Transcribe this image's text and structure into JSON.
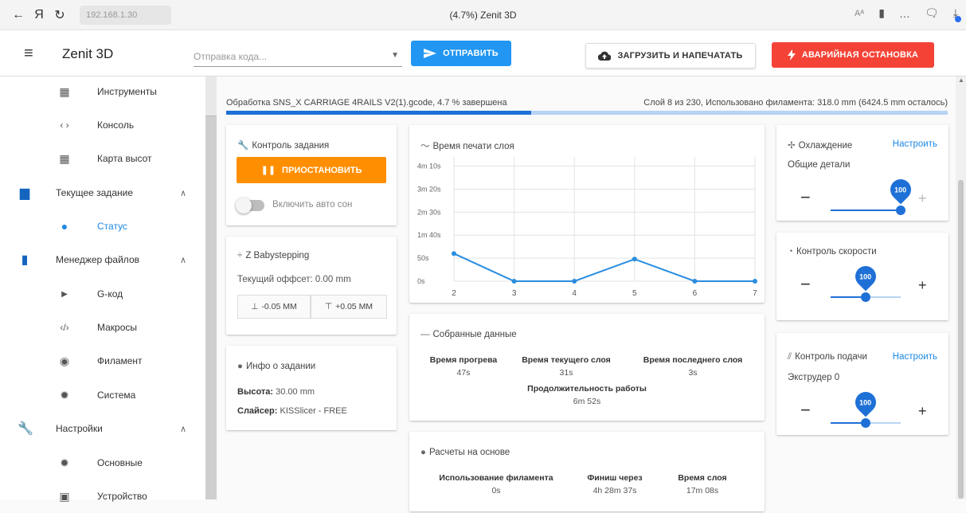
{
  "browser": {
    "address": "192.168.1.30",
    "tab_title": "(4.7%) Zenit 3D"
  },
  "appbar": {
    "title": "Zenit 3D",
    "gcode_placeholder": "Отправка кода...",
    "send_label": "ОТПРАВИТЬ",
    "upload_label": "ЗАГРУЗИТЬ И НАПЕЧАТАТЬ",
    "stop_label": "АВАРИЙНАЯ ОСТАНОВКА"
  },
  "sidebar": {
    "items": [
      {
        "label": "Инструменты",
        "icon": "tools-icon",
        "level": "child"
      },
      {
        "label": "Консоль",
        "icon": "code-icon",
        "level": "child"
      },
      {
        "label": "Карта высот",
        "icon": "grid-icon",
        "level": "child"
      },
      {
        "label": "Текущее задание",
        "icon": "printer-icon",
        "level": "parent"
      },
      {
        "label": "Статус",
        "icon": "info-icon",
        "level": "child",
        "active": true
      },
      {
        "label": "Менеджер файлов",
        "icon": "sd-card-icon",
        "level": "parent"
      },
      {
        "label": "G-код",
        "icon": "play-icon",
        "level": "child"
      },
      {
        "label": "Макросы",
        "icon": "macro-icon",
        "level": "child"
      },
      {
        "label": "Филамент",
        "icon": "radio-icon",
        "level": "child"
      },
      {
        "label": "Система",
        "icon": "gear-icon",
        "level": "child"
      },
      {
        "label": "Настройки",
        "icon": "wrench-icon",
        "level": "parent"
      },
      {
        "label": "Основные",
        "icon": "gear-icon",
        "level": "child"
      },
      {
        "label": "Устройство",
        "icon": "device-icon",
        "level": "child"
      }
    ]
  },
  "job": {
    "progress_text": "Обработка SNS_X CARRIAGE 4RAILS V2(1).gcode, 4.7 % завершена",
    "layer_text": "Слой 8 из 230, Использовано филамента: 318.0 mm (6424.5 mm осталось)",
    "progress": 0.047
  },
  "control": {
    "title": "Контроль задания",
    "pause_label": "ПРИОСТАНОВИТЬ",
    "auto_sleep_label": "Включить авто сон"
  },
  "babystep": {
    "title": "Z Babystepping",
    "offset_label": "Текущий оффсет: 0.00 mm",
    "minus_label": "-0.05 MM",
    "plus_label": "+0.05 MM"
  },
  "info": {
    "title": "Инфо о задании",
    "height_key": "Высота:",
    "height_val": "30.00 mm",
    "slicer_key": "Слайсер:",
    "slicer_val": "KISSlicer - FREE"
  },
  "chart_data": {
    "type": "line",
    "title": "Время печати слоя",
    "x": [
      2,
      3,
      4,
      5,
      6,
      7
    ],
    "values": [
      60,
      0,
      0,
      48,
      0,
      0
    ],
    "x_ticks": [
      "2",
      "3",
      "4",
      "5",
      "6",
      "7"
    ],
    "y_ticks": [
      {
        "v": 250,
        "label": "4m 10s"
      },
      {
        "v": 200,
        "label": "3m 20s"
      },
      {
        "v": 150,
        "label": "2m 30s"
      },
      {
        "v": 100,
        "label": "1m 40s"
      },
      {
        "v": 50,
        "label": "50s"
      },
      {
        "v": 0,
        "label": "0s"
      }
    ],
    "ylim": [
      0,
      270
    ],
    "xlim": [
      2,
      7
    ],
    "grid": true,
    "color": "#2a8de0"
  },
  "collected": {
    "title": "Собранные данные",
    "warmup_h": "Время прогрева",
    "warmup_v": "47s",
    "cur_layer_h": "Время текущего слоя",
    "cur_layer_v": "31s",
    "last_layer_h": "Время последнего слоя",
    "last_layer_v": "3s",
    "uptime_h": "Продолжительность работы",
    "uptime_v": "6m 52s"
  },
  "estimates": {
    "title": "Расчеты на основе",
    "fil_h": "Использование филамента",
    "fil_v": "0s",
    "finish_h": "Финиш через",
    "finish_v": "4h 28m 37s",
    "layer_h": "Время слоя",
    "layer_v": "17m 08s"
  },
  "cooling": {
    "title": "Охлаждение",
    "configure": "Настроить",
    "sub": "Общие детали",
    "value": "100",
    "fraction": 1.0
  },
  "speed": {
    "title": "Контроль скорости",
    "value": "100",
    "fraction": 0.5
  },
  "extrusion": {
    "title": "Контроль подачи",
    "configure": "Настроить",
    "sub": "Экструдер 0",
    "value": "100",
    "fraction": 0.5
  },
  "colors": {
    "accent": "#2196f3",
    "stop": "#f44336",
    "pause": "#ff8f00"
  }
}
